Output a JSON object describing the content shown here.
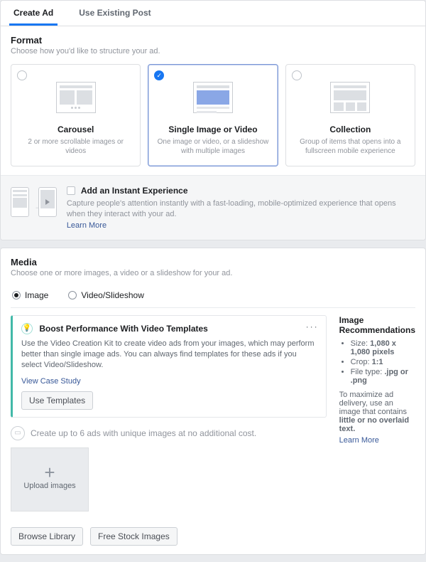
{
  "tabs": {
    "create": "Create Ad",
    "existing": "Use Existing Post"
  },
  "format": {
    "title": "Format",
    "subtitle": "Choose how you'd like to structure your ad.",
    "cards": [
      {
        "title": "Carousel",
        "desc": "2 or more scrollable images or videos"
      },
      {
        "title": "Single Image or Video",
        "desc": "One image or video, or a slideshow with multiple images"
      },
      {
        "title": "Collection",
        "desc": "Group of items that opens into a fullscreen mobile experience"
      }
    ]
  },
  "instant": {
    "title": "Add an Instant Experience",
    "desc": "Capture people's attention instantly with a fast-loading, mobile-optimized experience that opens when they interact with your ad.",
    "learn": "Learn More"
  },
  "media": {
    "title": "Media",
    "subtitle": "Choose one or more images, a video or a slideshow for your ad.",
    "radios": {
      "image": "Image",
      "video": "Video/Slideshow"
    },
    "tip": {
      "title": "Boost Performance With Video Templates",
      "desc": "Use the Video Creation Kit to create video ads from your images, which may perform better than single image ads. You can always find templates for these ads if you select Video/Slideshow.",
      "case": "View Case Study",
      "btn": "Use Templates"
    },
    "note": "Create up to 6 ads with unique images at no additional cost.",
    "upload": "Upload images",
    "browse": "Browse Library",
    "stock": "Free Stock Images",
    "recs": {
      "title": "Image Recommendations",
      "size_label": "Size: ",
      "size_value": "1,080 x 1,080 pixels",
      "crop_label": "Crop: ",
      "crop_value": "1:1",
      "type_label": "File type: ",
      "type_value": ".jpg or .png",
      "note_a": "To maximize ad delivery, use an image that contains ",
      "note_b": "little or no overlaid text.",
      "learn": "Learn More"
    }
  }
}
